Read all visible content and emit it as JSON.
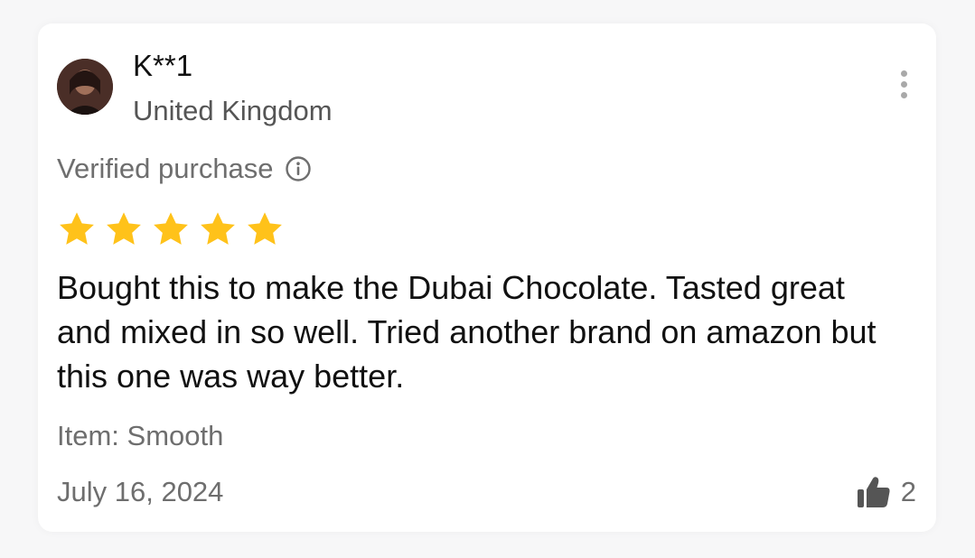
{
  "review": {
    "username": "K**1",
    "country": "United Kingdom",
    "verified_label": "Verified purchase",
    "rating": 5,
    "rating_max": 5,
    "text": "Bought this to make the Dubai Chocolate. Tasted great and mixed in so well. Tried another brand on amazon but this one was way better.",
    "item": "Item: Smooth",
    "date": "July 16, 2024",
    "likes": "2"
  },
  "icons": {
    "more": "more-vertical-icon",
    "info": "info-icon",
    "star": "star-icon",
    "like": "thumbs-up-icon"
  },
  "colors": {
    "star": "#FFC21A",
    "muted_text": "#6E6E6E",
    "primary_text": "#111111",
    "card_bg": "#FFFFFF",
    "page_bg": "#F7F7F8"
  }
}
